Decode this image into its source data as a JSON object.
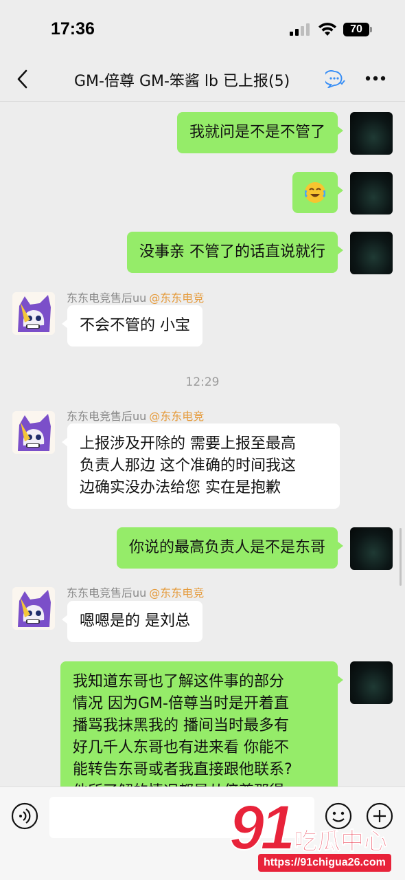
{
  "status_bar": {
    "time": "17:36",
    "battery": "70"
  },
  "nav": {
    "title": "GM-倍尊 GM-笨酱  lb 已上报(5)",
    "back_icon": "chevron-left-icon",
    "more_icon": "ellipsis-icon"
  },
  "messages": [
    {
      "from": "me",
      "text": "我就问是不是不管了"
    },
    {
      "from": "me",
      "emoji": "crying-laughing-emoji"
    },
    {
      "from": "me",
      "text": "没事亲 不管了的话直说就行"
    },
    {
      "from": "other",
      "sender": "东东电竞售后uu",
      "tag": "@东东电竞",
      "text": "不会不管的 小宝"
    },
    {
      "from": "other",
      "sender": "东东电竞售后uu",
      "tag": "@东东电竞",
      "lines": [
        "上报涉及开除的 需要上报至最高",
        "负责人那边 这个准确的时间我这",
        "边确实没办法给您 实在是抱歉"
      ]
    },
    {
      "from": "me",
      "text": "你说的最高负责人是不是东哥"
    },
    {
      "from": "other",
      "sender": "东东电竞售后uu",
      "tag": "@东东电竞",
      "text": "嗯嗯是的 是刘总"
    },
    {
      "from": "me",
      "lines": [
        "我知道东哥也了解这件事的部分",
        "情况 因为GM-倍尊当时是开着直",
        "播骂我抹黑我的 播间当时最多有",
        "好几千人东哥也有进来看 你能不",
        "能转告东哥或者我直接跟他联系?",
        "他所了解的情况都是从倍尊那得"
      ]
    }
  ],
  "timestamp": "12:29",
  "input_bar": {
    "input_value": "",
    "voice_icon": "voice-icon",
    "emoji_icon": "smiley-icon",
    "plus_icon": "plus-icon"
  },
  "watermark": {
    "number": "91",
    "text": "吃瓜中心",
    "url": "https://91chigua26.com"
  },
  "colors": {
    "background": "#ededed",
    "my_bubble": "#95ec69",
    "other_bubble": "#ffffff",
    "tag": "#e59a3a",
    "watermark": "#e8233a"
  }
}
